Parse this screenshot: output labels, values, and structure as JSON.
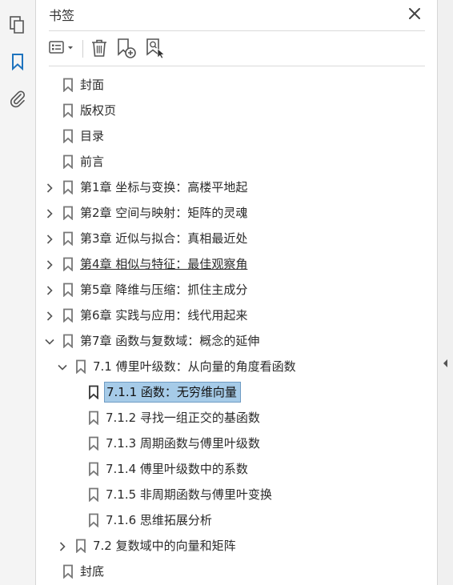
{
  "panel": {
    "title": "书签"
  },
  "icons": {
    "pages": "pages-icon",
    "bookmarks": "bookmark-ribbon-icon",
    "attachments": "paperclip-icon",
    "close": "close-icon",
    "options": "options-list-icon",
    "delete": "trash-icon",
    "new_bookmark": "new-bookmark-icon",
    "new_from_structure": "bookmark-search-icon"
  },
  "colors": {
    "accent": "#1e73be",
    "selection_bg": "#a6cbe8",
    "selection_border": "#6f9cc4"
  },
  "bookmarks": [
    {
      "label": "封面",
      "level": 0,
      "expander": "none"
    },
    {
      "label": "版权页",
      "level": 0,
      "expander": "none"
    },
    {
      "label": "目录",
      "level": 0,
      "expander": "none"
    },
    {
      "label": "前言",
      "level": 0,
      "expander": "none"
    },
    {
      "label": "第1章 坐标与变换：高楼平地起",
      "level": 0,
      "expander": "collapsed"
    },
    {
      "label": "第2章 空间与映射：矩阵的灵魂",
      "level": 0,
      "expander": "collapsed"
    },
    {
      "label": "第3章 近似与拟合：真相最近处",
      "level": 0,
      "expander": "collapsed"
    },
    {
      "label": "第4章 相似与特征：最佳观察角",
      "level": 0,
      "expander": "collapsed",
      "underlined": true
    },
    {
      "label": "第5章 降维与压缩：抓住主成分",
      "level": 0,
      "expander": "collapsed"
    },
    {
      "label": "第6章 实践与应用：线代用起来",
      "level": 0,
      "expander": "collapsed"
    },
    {
      "label": "第7章 函数与复数域：概念的延伸",
      "level": 0,
      "expander": "expanded"
    },
    {
      "label": "7.1 傅里叶级数：从向量的角度看函数",
      "level": 1,
      "expander": "expanded"
    },
    {
      "label": "7.1.1 函数：无穷维向量",
      "level": 2,
      "expander": "none",
      "selected": true
    },
    {
      "label": "7.1.2 寻找一组正交的基函数",
      "level": 2,
      "expander": "none"
    },
    {
      "label": "7.1.3 周期函数与傅里叶级数",
      "level": 2,
      "expander": "none"
    },
    {
      "label": "7.1.4 傅里叶级数中的系数",
      "level": 2,
      "expander": "none"
    },
    {
      "label": "7.1.5 非周期函数与傅里叶变换",
      "level": 2,
      "expander": "none"
    },
    {
      "label": "7.1.6 思维拓展分析",
      "level": 2,
      "expander": "none"
    },
    {
      "label": "7.2 复数域中的向量和矩阵",
      "level": 1,
      "expander": "collapsed"
    },
    {
      "label": "封底",
      "level": 0,
      "expander": "none"
    }
  ]
}
